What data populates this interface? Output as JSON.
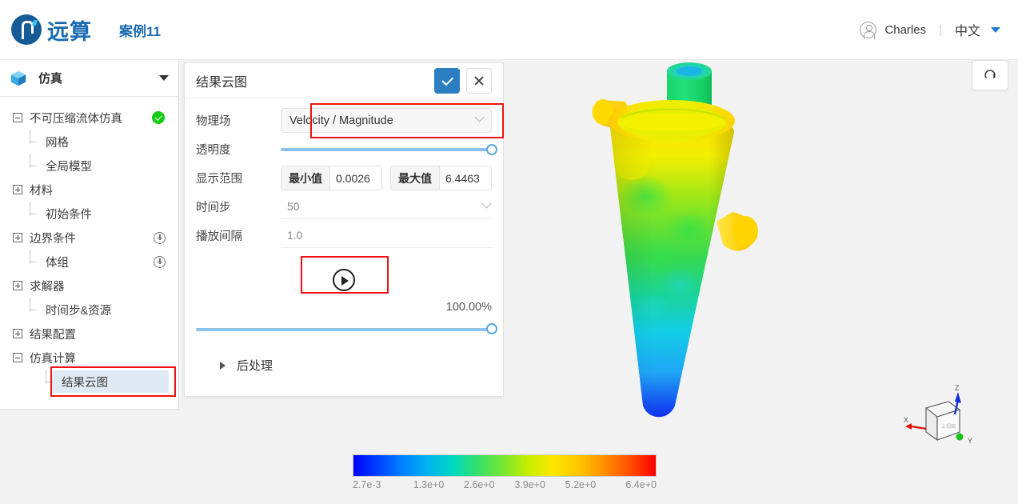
{
  "header": {
    "brand": "远算",
    "case_title": "案例11",
    "user_name": "Charles",
    "separator": "|",
    "language": "中文"
  },
  "sidebar": {
    "header_label": "仿真",
    "tree": [
      {
        "label": "不可压缩流体仿真",
        "level": 0,
        "marker": "minus",
        "badge": "ok"
      },
      {
        "label": "网格",
        "level": 1,
        "marker": "tick"
      },
      {
        "label": "全局模型",
        "level": 1,
        "marker": "tick"
      },
      {
        "label": "材料",
        "level": 0,
        "marker": "plus"
      },
      {
        "label": "初始条件",
        "level": 1,
        "marker": "tick"
      },
      {
        "label": "边界条件",
        "level": 0,
        "marker": "plus",
        "badge": "add"
      },
      {
        "label": "体组",
        "level": 1,
        "marker": "tick",
        "badge": "add"
      },
      {
        "label": "求解器",
        "level": 0,
        "marker": "plus"
      },
      {
        "label": "时间步&资源",
        "level": 1,
        "marker": "tick"
      },
      {
        "label": "结果配置",
        "level": 0,
        "marker": "plus"
      },
      {
        "label": "仿真计算",
        "level": 0,
        "marker": "minus"
      },
      {
        "label": "结果云图",
        "level": 2,
        "marker": "tick",
        "selected": true
      }
    ]
  },
  "panel": {
    "title": "结果云图",
    "confirm_label": "✓",
    "cancel_label": "✕",
    "fields": {
      "physical_field_label": "物理场",
      "physical_field_value": "Velocity / Magnitude",
      "opacity_label": "透明度",
      "opacity_percent": 100,
      "range_label": "显示范围",
      "min_tag": "最小值",
      "min_value": "0.0026",
      "max_tag": "最大值",
      "max_value": "6.4463",
      "timestep_label": "时间步",
      "timestep_value": "50",
      "interval_label": "播放间隔",
      "interval_value": "1.0"
    },
    "playback": {
      "play_icon": "play-circle-icon",
      "progress_text": "100.00%",
      "progress_percent": 100
    },
    "postprocess_label": "后处理"
  },
  "viewport": {
    "reset_icon": "reset-view-icon",
    "axes": {
      "x": "X",
      "y": "Y",
      "z": "Z"
    }
  },
  "chart_data": {
    "type": "heatmap",
    "title": "Velocity / Magnitude",
    "colormap": "rainbow",
    "ticks": [
      "2.7e-3",
      "1.3e+0",
      "2.6e+0",
      "3.9e+0",
      "5.2e+0",
      "6.4e+0"
    ],
    "vmin": 0.0026,
    "vmax": 6.4463,
    "legend_position": "bottom"
  },
  "colors": {
    "brand": "#1b6bb0",
    "accent": "#2b7ec1",
    "status_ok": "#15cc15",
    "annotation": "#ee1111",
    "selection": "#dfeaf4"
  }
}
